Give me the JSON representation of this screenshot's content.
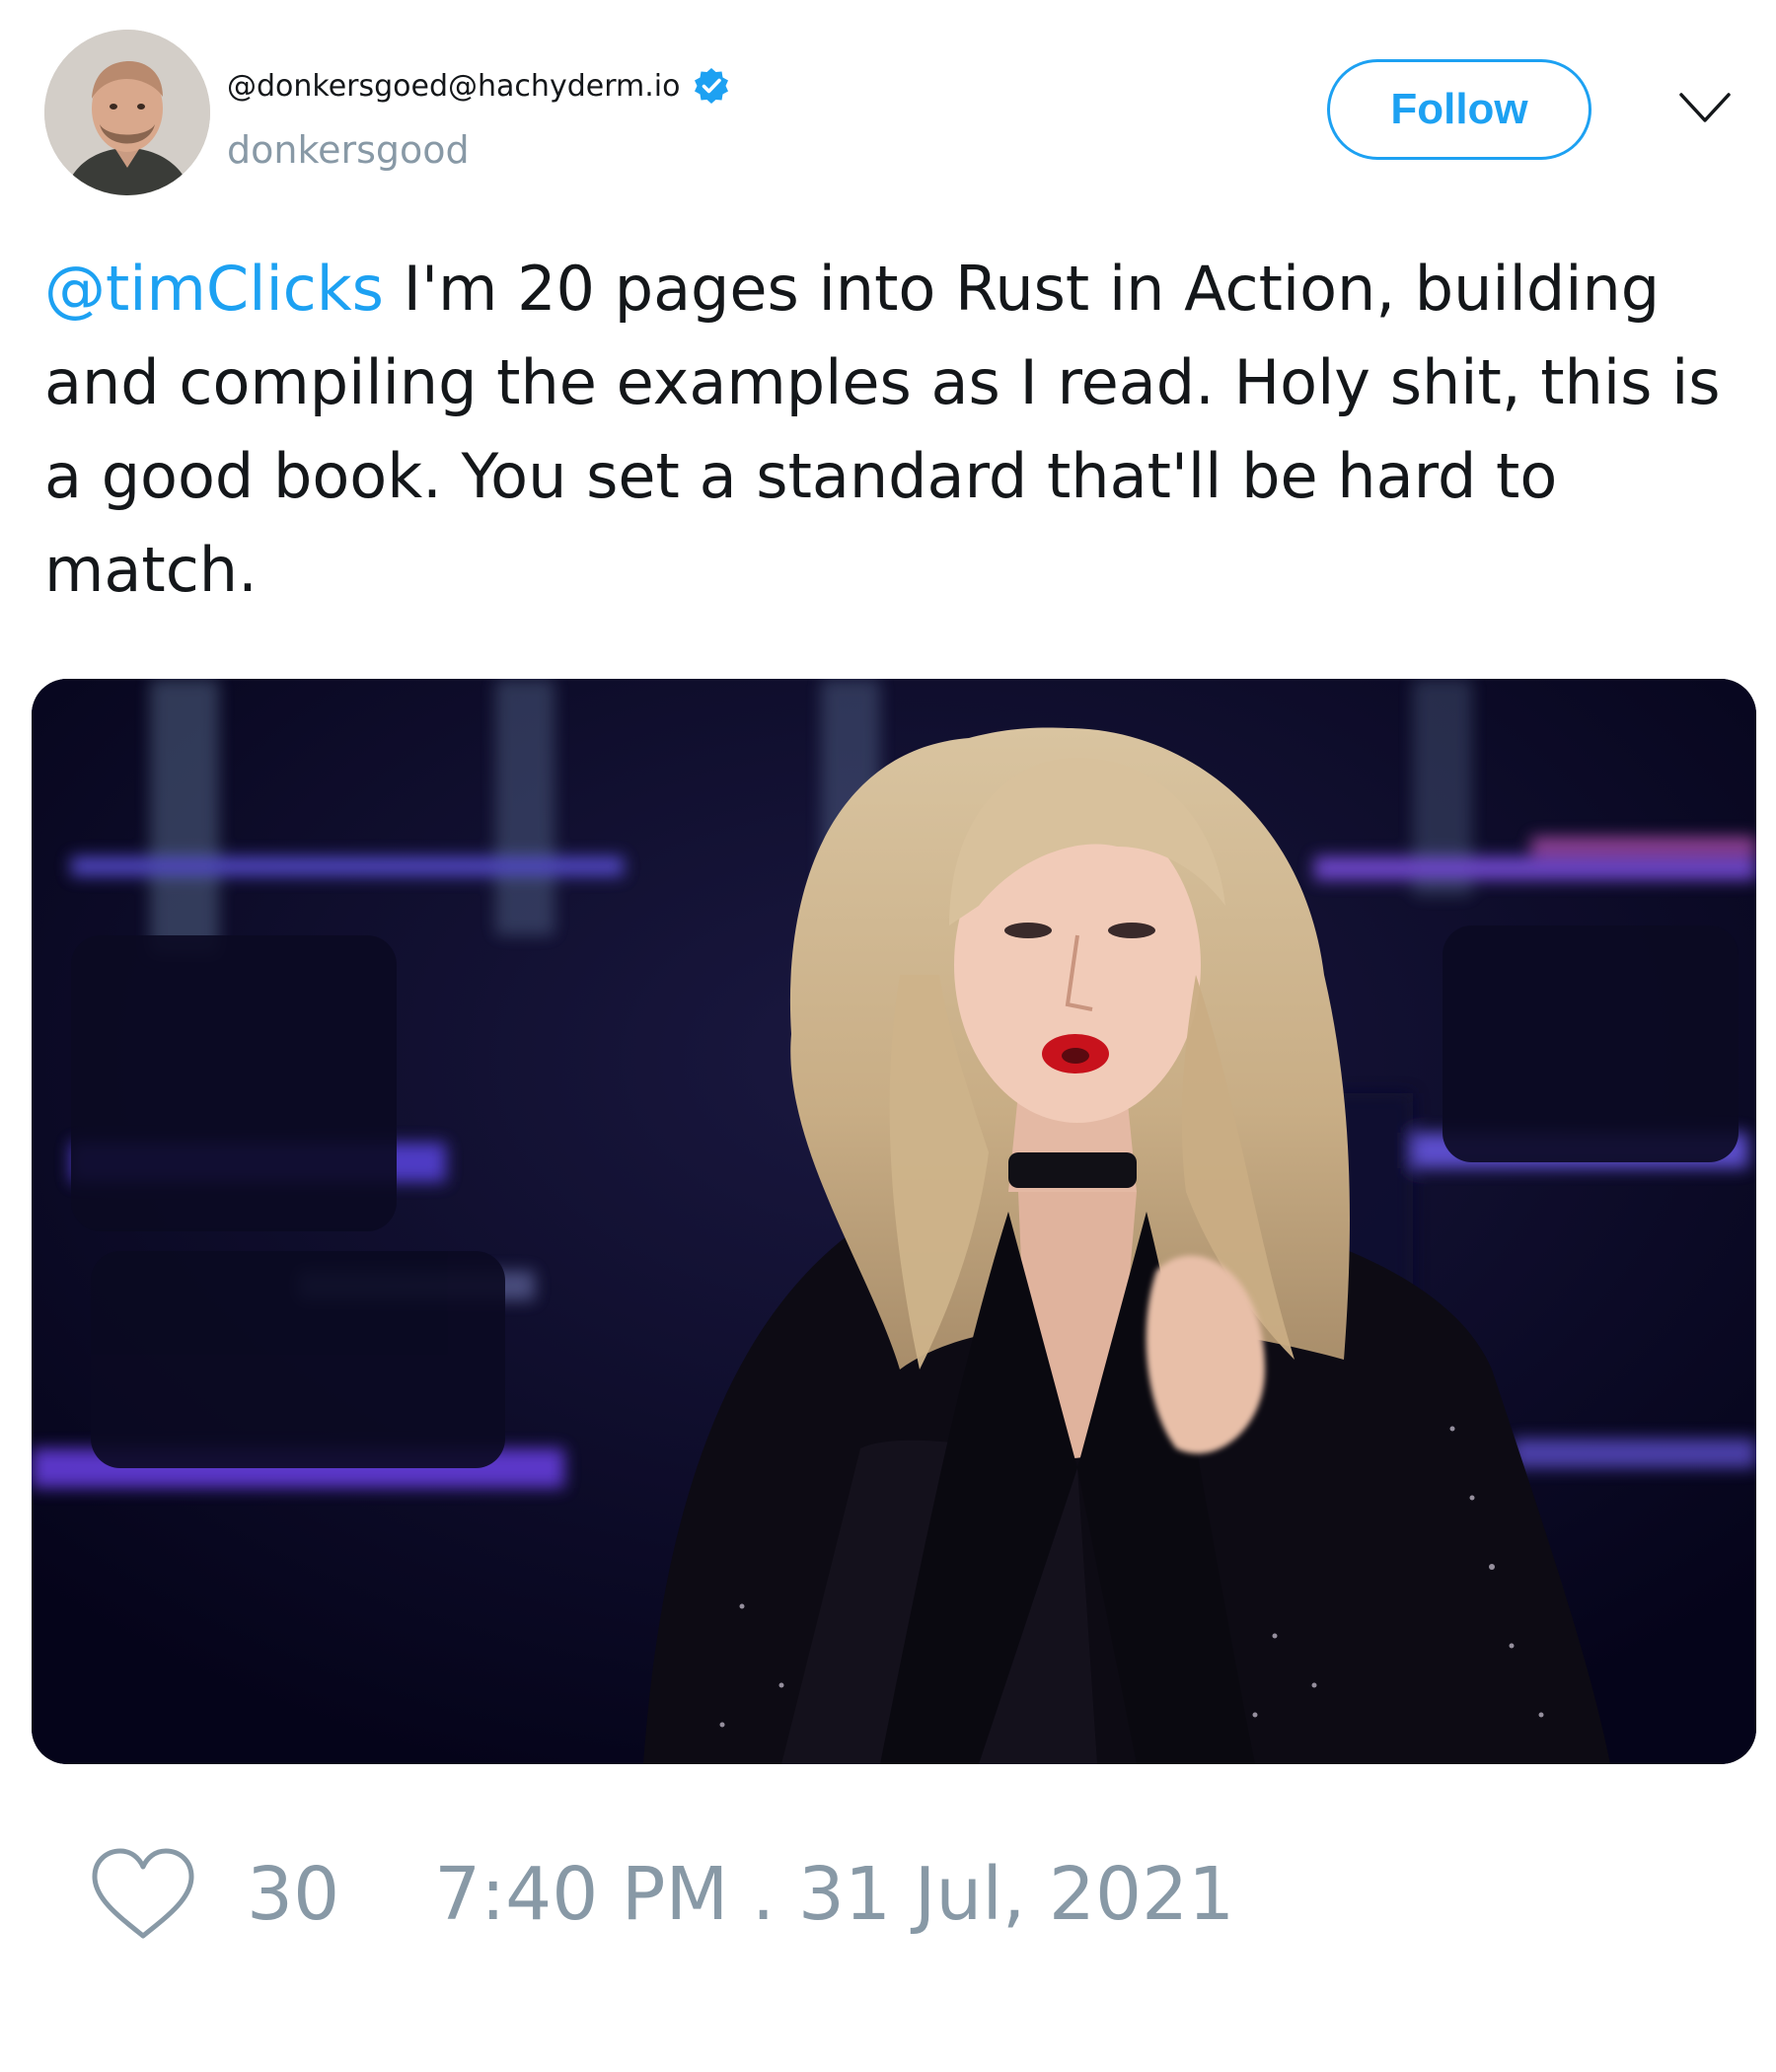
{
  "author": {
    "handle": "@donkersgoed@hachyderm.io",
    "username": "donkersgood",
    "verified": true
  },
  "follow_button": {
    "label": "Follow"
  },
  "icons": {
    "avatar": "profile-photo",
    "verified": "verified-badge-icon",
    "menu": "chevron-down-icon",
    "like": "heart-outline-icon"
  },
  "tweet": {
    "mention": "@timClicks",
    "text": " I'm 20 pages into Rust in Action, building and compiling the examples as I read. Holy shit, this is a good book. You set a standard that'll be hard to match."
  },
  "media": {
    "type": "animated-gif"
  },
  "footer": {
    "like_count": "30",
    "timestamp": "7:40 PM . 31 Jul, 2021"
  },
  "colors": {
    "accent": "#1da1f2",
    "muted_text": "#8899a6",
    "body_text": "#14171a"
  }
}
